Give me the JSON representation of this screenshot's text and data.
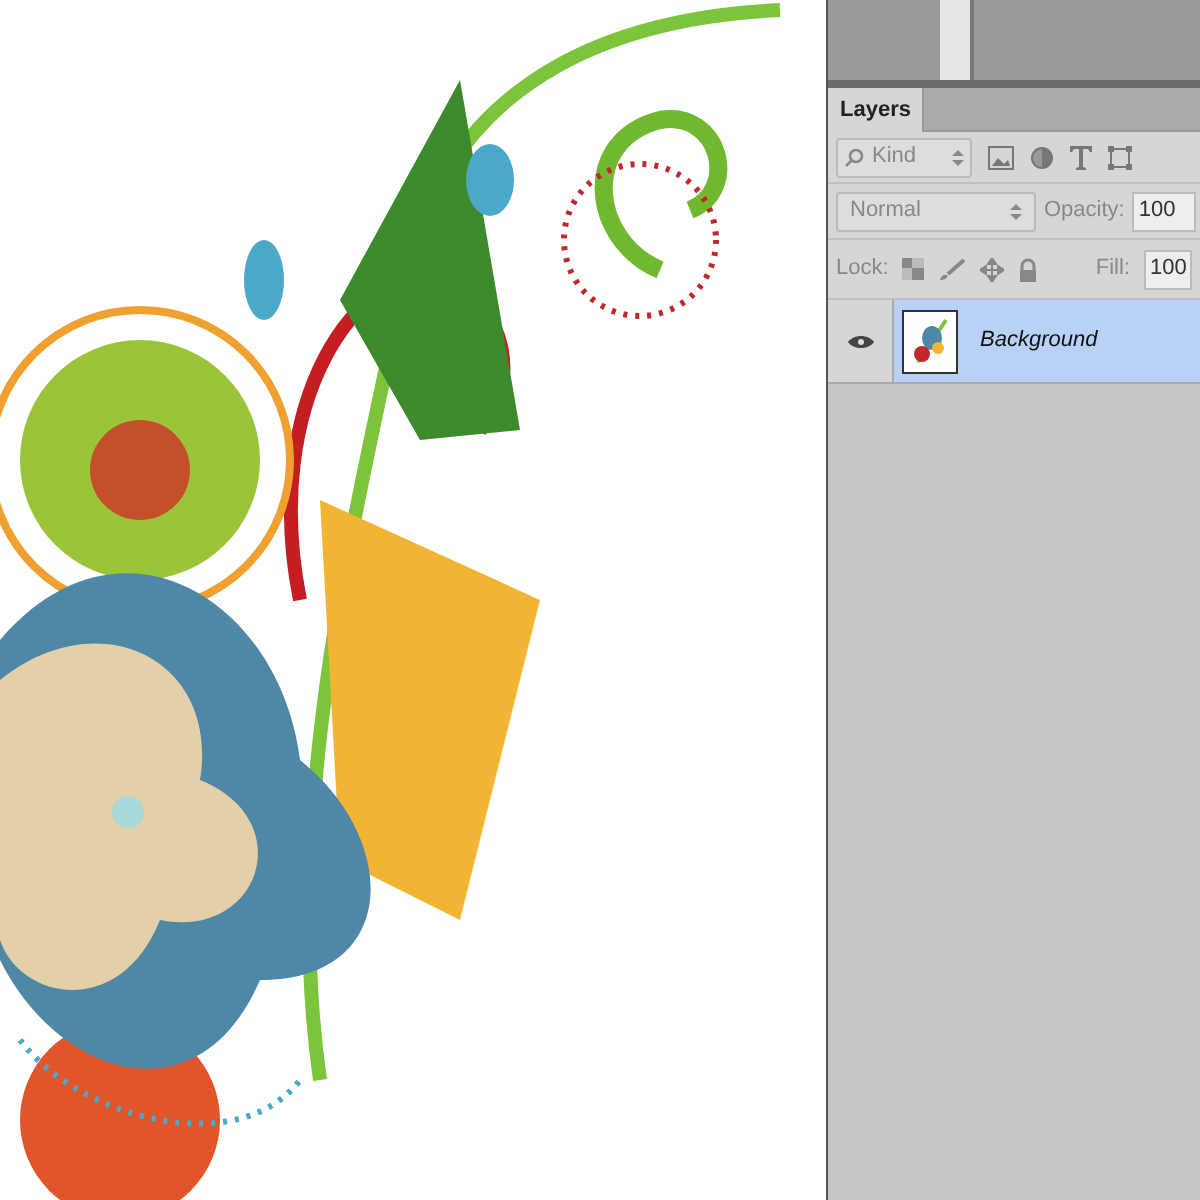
{
  "panel": {
    "tabs": [
      {
        "label": "Layers",
        "selected": true
      }
    ],
    "filter": {
      "value": "Kind"
    },
    "blend_mode": {
      "value": "Normal"
    },
    "opacity": {
      "label": "Opacity:",
      "value": "100"
    },
    "lock": {
      "label": "Lock:"
    },
    "fill": {
      "label": "Fill:",
      "value": "100"
    },
    "layers": [
      {
        "name": "Background",
        "visible": true,
        "selected": true
      }
    ]
  }
}
